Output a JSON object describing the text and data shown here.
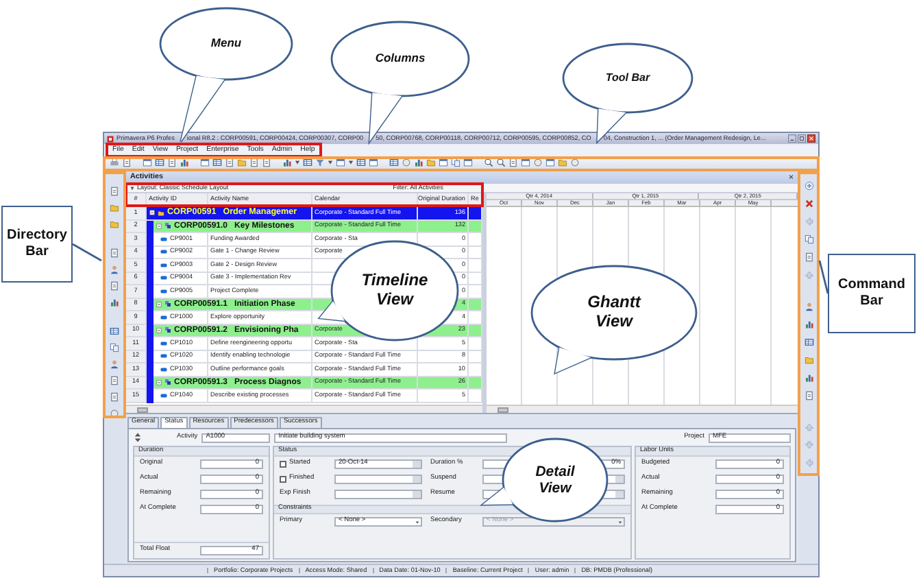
{
  "window": {
    "title_segments": [
      "Primavera P6 Profes",
      "ional R8.2 : CORP00591, CORP00424, CORP00307, CORP00",
      "50, CORP00768, CORP00118, CORP00712, CORP00595, CORP00852, CO",
      "04, Construction 1, ... (Order Management Redesign, Le..."
    ]
  },
  "menu": [
    "File",
    "Edit",
    "View",
    "Project",
    "Enterprise",
    "Tools",
    "Admin",
    "Help"
  ],
  "activities": {
    "title": "Activities",
    "close": "×",
    "layout": "Layout: Classic Schedule Layout",
    "filter": "Filter: All Activities",
    "columns": [
      "#",
      "Activity ID",
      "Activity Name",
      "Calendar",
      "Original Duration",
      "Re"
    ],
    "rows": [
      {
        "kind": "project",
        "number": "1",
        "code": "CORP00591",
        "name": "Order Managemer",
        "calendar": "Corporate - Standard Full Time",
        "duration": "136"
      },
      {
        "kind": "wbs",
        "number": "2",
        "code": "CORP00591.0",
        "name": "Key Milestones",
        "calendar": "Corporate - Standard Full Time",
        "duration": "132"
      },
      {
        "kind": "activity",
        "number": "3",
        "id": "CP9001",
        "name": "Funding Awarded",
        "calendar": "Corporate - Sta",
        "duration": "0"
      },
      {
        "kind": "activity",
        "number": "4",
        "id": "CP9002",
        "name": "Gate 1 - Change Review",
        "calendar": "Corporate",
        "duration": "0"
      },
      {
        "kind": "activity",
        "number": "5",
        "id": "CP9003",
        "name": "Gate 2 - Design Review",
        "duration": "0"
      },
      {
        "kind": "activity",
        "number": "6",
        "id": "CP9004",
        "name": "Gate 3 - Implementation Rev",
        "duration": "0"
      },
      {
        "kind": "activity",
        "number": "7",
        "id": "CP9005",
        "name": "Project Complete",
        "duration": "0"
      },
      {
        "kind": "wbs",
        "number": "8",
        "code": "CORP00591.1",
        "name": "Initiation Phase",
        "duration": "4"
      },
      {
        "kind": "activity",
        "number": "9",
        "id": "CP1000",
        "name": "Explore opportunity",
        "duration": "4"
      },
      {
        "kind": "wbs",
        "number": "10",
        "code": "CORP00591.2",
        "name": "Envisioning Pha",
        "calendar": "Corporate",
        "duration": "23"
      },
      {
        "kind": "activity",
        "number": "11",
        "id": "CP1010",
        "name": "Define reengineering opportu",
        "calendar": "Corporate - Sta",
        "duration": "5"
      },
      {
        "kind": "activity",
        "number": "12",
        "id": "CP1020",
        "name": "Identify enabling technologie",
        "calendar": "Corporate - Standard Full Time",
        "duration": "8"
      },
      {
        "kind": "activity",
        "number": "13",
        "id": "CP1030",
        "name": "Outline performance goals",
        "calendar": "Corporate - Standard Full Time",
        "duration": "10"
      },
      {
        "kind": "wbs",
        "number": "14",
        "code": "CORP00591.3",
        "name": "Process Diagnos",
        "calendar": "Corporate - Standard Full Time",
        "duration": "26"
      },
      {
        "kind": "activity",
        "number": "15",
        "id": "CP1040",
        "name": "Describe existing processes",
        "calendar": "Corporate - Standard Full Time",
        "duration": "5"
      }
    ]
  },
  "gantt": {
    "quarters": [
      "Qtr 4, 2014",
      "Qtr 1, 2015",
      "Qtr 2, 2015"
    ],
    "months": [
      "Oct",
      "Nov",
      "Dec",
      "Jan",
      "Feb",
      "Mar",
      "Apr",
      "May"
    ]
  },
  "detail": {
    "tabs": [
      {
        "label": "General",
        "selected": false
      },
      {
        "label": "Status",
        "selected": true
      },
      {
        "label": "Resources",
        "selected": false
      },
      {
        "label": "Predecessors",
        "selected": false
      },
      {
        "label": "Successors",
        "selected": false
      }
    ],
    "activity_label": "Activity",
    "activity_id": "A1000",
    "activity_name": "Initiate building system",
    "project_label": "Project",
    "project": "MFE",
    "duration": {
      "title": "Duration",
      "fields": [
        {
          "label": "Original",
          "value": "0"
        },
        {
          "label": "Actual",
          "value": "0"
        },
        {
          "label": "Remaining",
          "value": "0"
        },
        {
          "label": "At Complete",
          "value": "0"
        }
      ],
      "total_float": {
        "label": "Total Float",
        "value": "47"
      }
    },
    "status": {
      "title": "Status",
      "rows": [
        {
          "kind": "check",
          "label": "Started",
          "checked": false,
          "value": "20-Oct-14"
        },
        {
          "kind": "check",
          "label": "Finished",
          "checked": false
        },
        {
          "kind": "plain",
          "label": "Exp Finish"
        }
      ],
      "right": [
        {
          "label": "Duration %",
          "value": "0%"
        },
        {
          "label": "Suspend"
        },
        {
          "label": "Resume"
        }
      ]
    },
    "constraints": {
      "title": "Constraints",
      "primary": {
        "label": "Primary",
        "value": "< None >",
        "disabled": false
      },
      "secondary": {
        "label": "Secondary",
        "value": "< None >",
        "disabled": true
      }
    },
    "labor_units": {
      "title": "Labor Units",
      "fields": [
        {
          "label": "Budgeted",
          "value": "0"
        },
        {
          "label": "Actual",
          "value": "0"
        },
        {
          "label": "Remaining",
          "value": "0"
        },
        {
          "label": "At Complete",
          "value": "0"
        }
      ]
    }
  },
  "status_bar": [
    "Portfolio: Corporate Projects",
    "Access Mode: Shared",
    "Data Date: 01-Nov-10",
    "Baseline: Current Project",
    "User: admin",
    "DB: PMDB (Professional)"
  ],
  "callouts": [
    {
      "kind": "bubble",
      "text": "Menu"
    },
    {
      "kind": "bubble",
      "text": "Columns"
    },
    {
      "kind": "bubble",
      "text": "Tool Bar"
    },
    {
      "kind": "box",
      "text": "Directory Bar"
    },
    {
      "kind": "bubble",
      "text": "Timeline View"
    },
    {
      "kind": "bubble",
      "text": "Ghantt View"
    },
    {
      "kind": "box",
      "text": "Command Bar"
    },
    {
      "kind": "bubble",
      "text": "Detail View"
    }
  ]
}
